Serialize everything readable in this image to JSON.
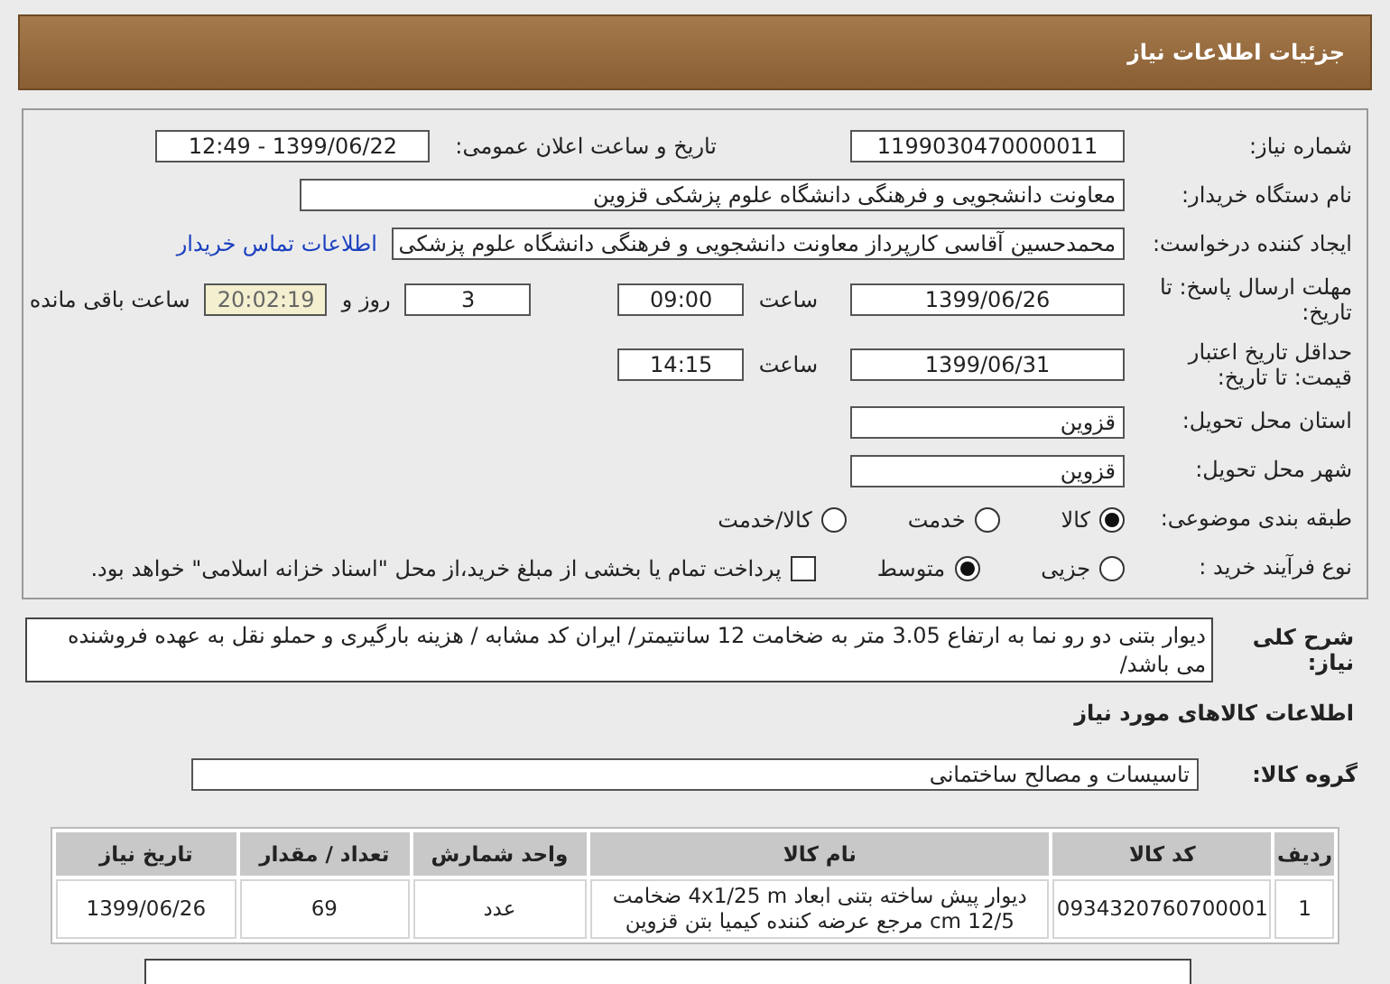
{
  "title": "جزئیات اطلاعات نیاز",
  "need_number": {
    "label": "شماره نیاز:",
    "value": "1199030470000011"
  },
  "announce": {
    "label": "تاریخ و ساعت اعلان عمومی:",
    "value": "1399/06/22 - 12:49"
  },
  "buyer": {
    "label": "نام دستگاه خریدار:",
    "value": "معاونت دانشجویی و فرهنگی دانشگاه علوم پزشکی قزوین"
  },
  "requester": {
    "label": "ایجاد کننده درخواست:",
    "value": "محمدحسین آقاسی کارپرداز معاونت دانشجویی و فرهنگی دانشگاه علوم پزشکی",
    "link": "اطلاعات تماس خریدار"
  },
  "deadline": {
    "label": "مهلت ارسال پاسخ: تا تاریخ:",
    "date": "1399/06/26",
    "time_label": "ساعت",
    "time": "09:00",
    "days": "3",
    "days_label": "روز و",
    "remaining": "20:02:19",
    "remaining_label": "ساعت باقی مانده"
  },
  "validity": {
    "label": "حداقل تاریخ اعتبار قیمت: تا تاریخ:",
    "date": "1399/06/31",
    "time_label": "ساعت",
    "time": "14:15"
  },
  "province": {
    "label": "استان محل تحویل:",
    "value": "قزوین"
  },
  "city": {
    "label": "شهر محل تحویل:",
    "value": "قزوین"
  },
  "category": {
    "label": "طبقه بندی موضوعی:",
    "options": [
      {
        "label": "کالا",
        "selected": true
      },
      {
        "label": "خدمت",
        "selected": false
      },
      {
        "label": "کالا/خدمت",
        "selected": false
      }
    ]
  },
  "process": {
    "label": "نوع فرآیند خرید :",
    "options": [
      {
        "label": "جزیی",
        "selected": false
      },
      {
        "label": "متوسط",
        "selected": true
      }
    ],
    "treasury": {
      "label": "پرداخت تمام یا بخشی از مبلغ خرید،از محل \"اسناد خزانه اسلامی\" خواهد بود.",
      "checked": false
    }
  },
  "description": {
    "label": "شرح کلی نیاز:",
    "value": "دیوار بتنی دو رو نما به ارتفاع 3.05 متر به ضخامت 12 سانتیمتر/ ایران کد مشابه / هزینه بارگیری و حملو نقل به عهده فروشنده می باشد/"
  },
  "goods_heading": "اطلاعات کالاهای مورد نیاز",
  "goods_group": {
    "label": "گروه کالا:",
    "value": "تاسیسات و مصالح ساختمانی"
  },
  "table": {
    "columns": [
      "ردیف",
      "کد کالا",
      "نام کالا",
      "واحد شمارش",
      "تعداد / مقدار",
      "تاریخ نیاز"
    ],
    "rows": [
      [
        "1",
        "0934320760700001",
        "دیوار پیش ساخته بتنی ابعاد 4x1/25 m ضخامت 12/5 cm مرجع عرضه کننده کیمیا بتن قزوین",
        "عدد",
        "69",
        "1399/06/26"
      ]
    ]
  }
}
